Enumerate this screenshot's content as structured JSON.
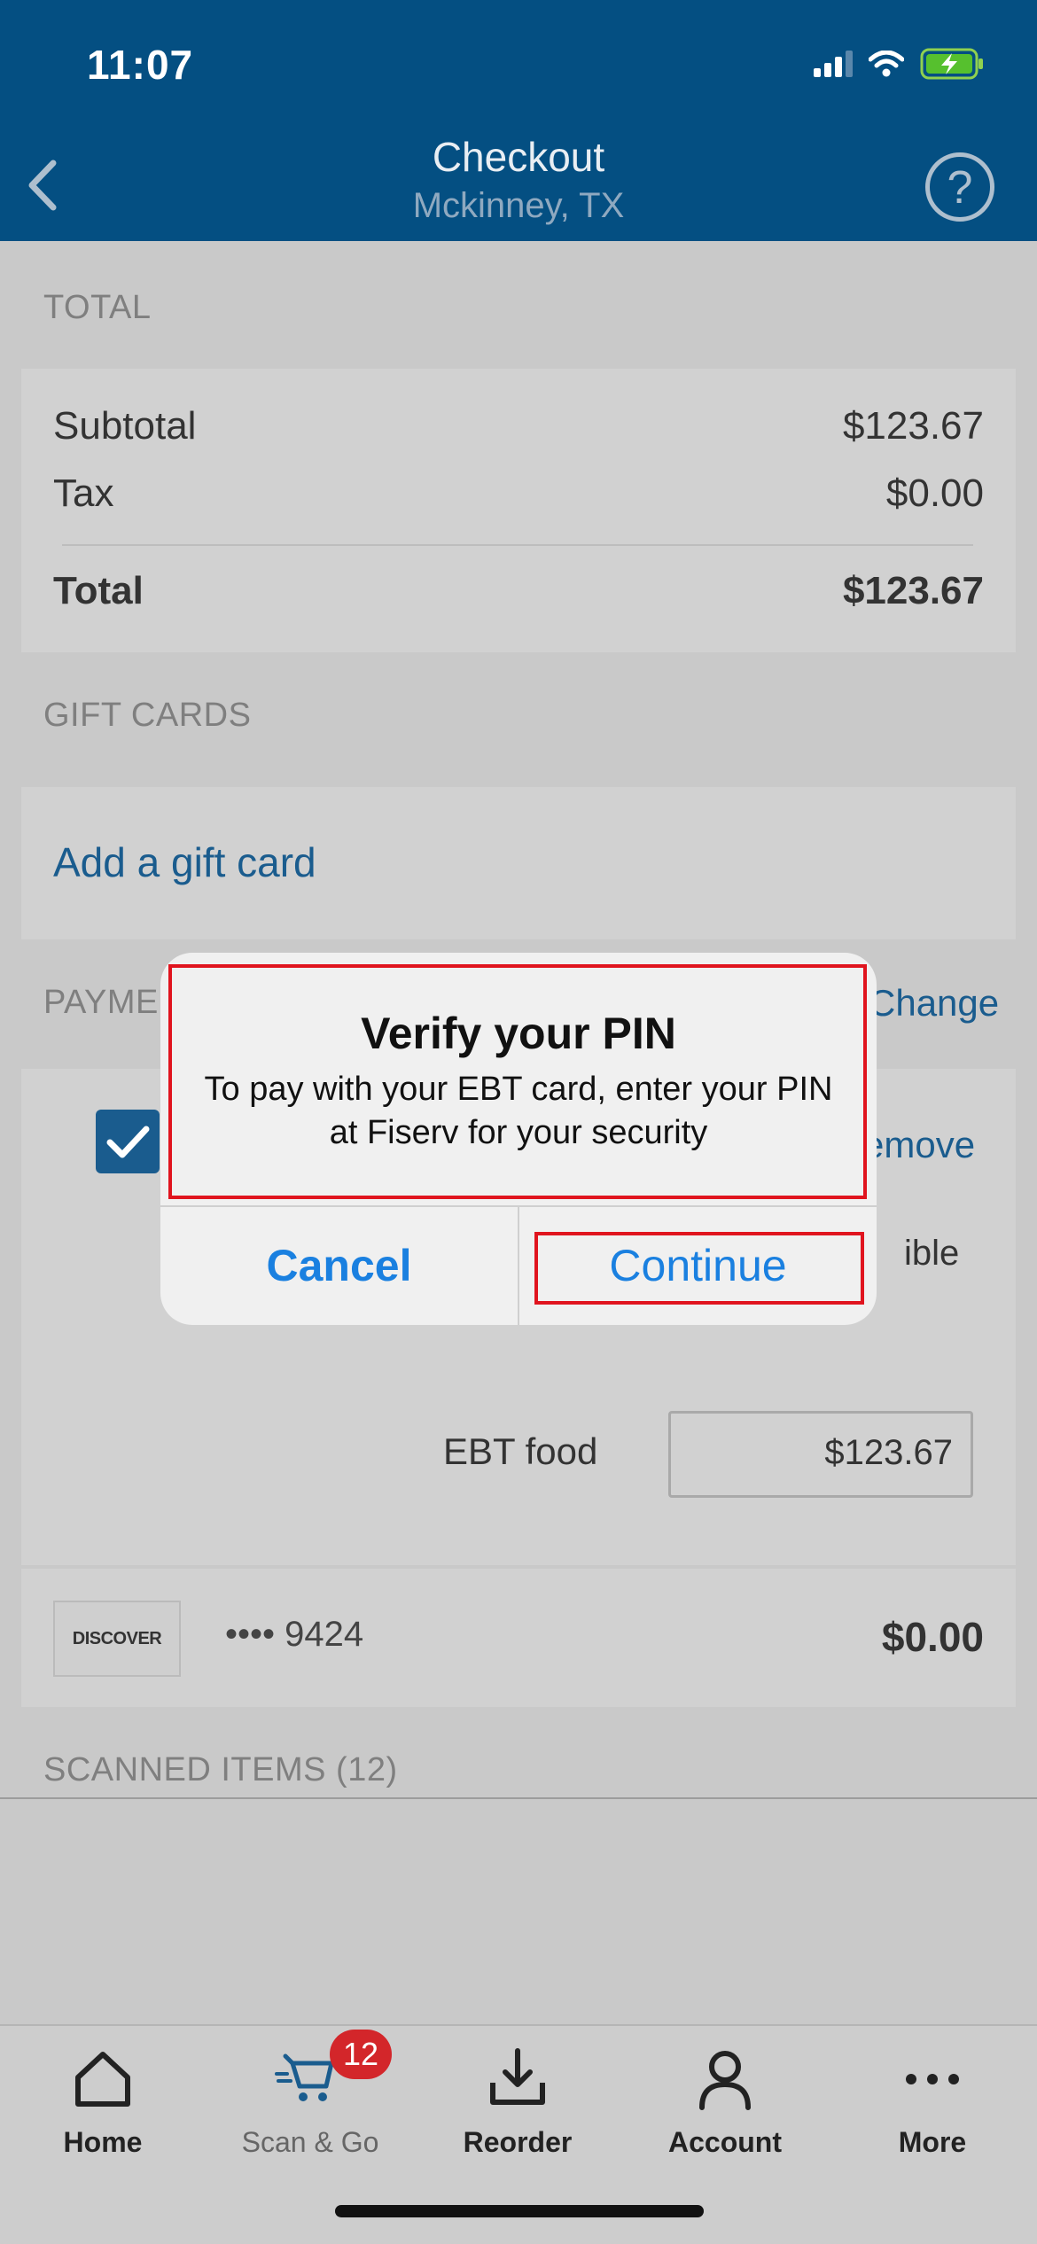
{
  "status_bar": {
    "time": "11:07"
  },
  "nav": {
    "title": "Checkout",
    "subtitle": "Mckinney, TX",
    "help_glyph": "?"
  },
  "total_section": {
    "label": "TOTAL",
    "subtotal_label": "Subtotal",
    "subtotal_value": "$123.67",
    "tax_label": "Tax",
    "tax_value": "$0.00",
    "total_label": "Total",
    "total_value": "$123.67"
  },
  "gift_cards": {
    "label": "GIFT CARDS",
    "add_link": "Add a gift card"
  },
  "payment": {
    "label_visible": "PAYME",
    "change_visible": "Change",
    "remove_visible": "emove",
    "eligible_visible": "ible",
    "ebt_label": "EBT food",
    "ebt_amount": "$123.67",
    "card_brand": "DISCOVER",
    "card_mask": "•••• 9424",
    "card_amount": "$0.00"
  },
  "scanned": {
    "label": "SCANNED ITEMS (12)"
  },
  "dialog": {
    "title": "Verify your PIN",
    "message": "To pay with your EBT card, enter your PIN at Fiserv for your security",
    "cancel": "Cancel",
    "continue": "Continue"
  },
  "tabs": [
    {
      "label": "Home",
      "icon": "home-icon"
    },
    {
      "label": "Scan & Go",
      "icon": "cart-icon",
      "badge": "12"
    },
    {
      "label": "Reorder",
      "icon": "reorder-icon"
    },
    {
      "label": "Account",
      "icon": "person-icon"
    },
    {
      "label": "More",
      "icon": "more-icon"
    }
  ],
  "colors": {
    "nav": "#044f82",
    "accent": "#1a80e0",
    "highlight": "#e0141e",
    "badge": "#d3262a"
  }
}
